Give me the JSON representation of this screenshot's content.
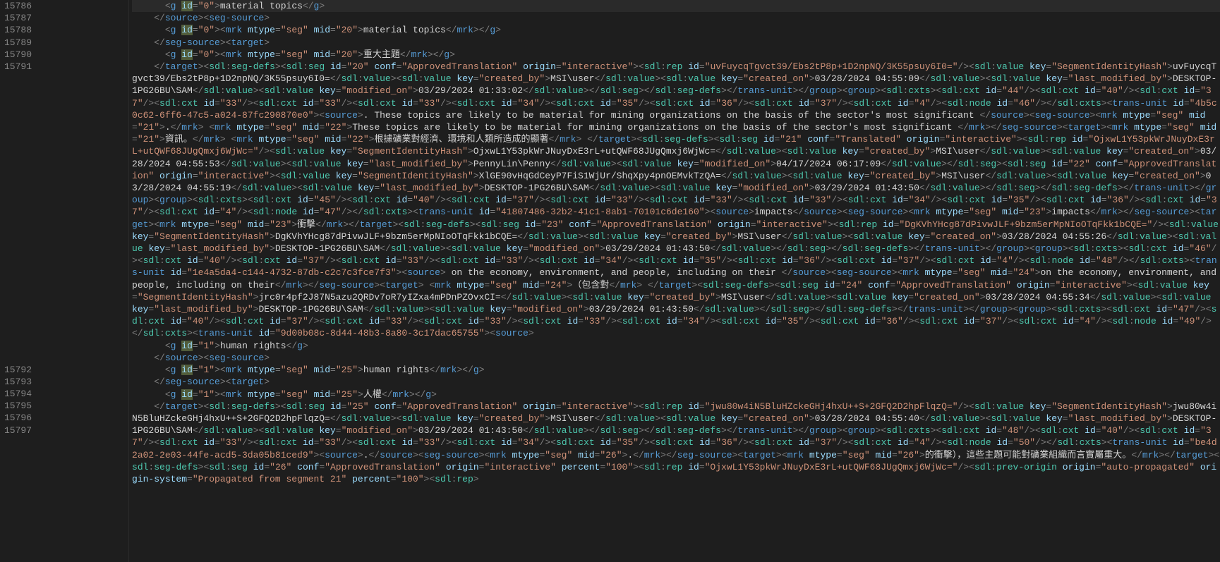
{
  "lineNumbers": [
    "15786",
    "15787",
    "15788",
    "15789",
    "15790",
    "15791",
    "",
    "",
    "",
    "",
    "",
    "",
    "",
    "",
    "",
    "",
    "",
    "",
    "",
    "",
    "",
    "",
    "",
    "",
    "",
    "",
    "",
    "",
    "",
    "",
    "15792",
    "15793",
    "15794",
    "15795",
    "15796",
    "15797",
    "",
    "",
    "",
    "",
    ""
  ],
  "tokens": {
    "g": "g",
    "id": "id",
    "eq": "=",
    "lt": "<",
    "gt": ">",
    "slash": "/",
    "quote": "\"",
    "source": "source",
    "seg_source": "seg-source",
    "target": "target",
    "mrk": "mrk",
    "mtype": "mtype",
    "seg": "seg",
    "mid": "mid",
    "sdl_seg_defs": "sdl:seg-defs",
    "sdl_seg": "sdl:seg",
    "conf": "conf",
    "ApprovedTranslation": "ApprovedTranslation",
    "Translated": "Translated",
    "origin": "origin",
    "interactive": "interactive",
    "auto_propagated": "auto-propagated",
    "sdl_rep": "sdl:rep",
    "sdl_value": "sdl:value",
    "key": "key",
    "SegmentIdentityHash": "SegmentIdentityHash",
    "created_by": "created_by",
    "created_on": "created_on",
    "last_modified_by": "last_modified_by",
    "modified_on": "modified_on",
    "trans_unit": "trans-unit",
    "group": "group",
    "sdl_cxts": "sdl:cxts",
    "sdl_cxt": "sdl:cxt",
    "sdl_node": "sdl:node",
    "sdl_prev_origin": "sdl:prev-origin",
    "origin_system": "origin-system",
    "percent": "percent"
  },
  "values": {
    "zero": "0",
    "one": "1",
    "four": "4",
    "mid20": "20",
    "mid21": "21",
    "mid22": "22",
    "mid23": "23",
    "mid24": "24",
    "mid25": "25",
    "mid26": "26",
    "material_topics": "material topics",
    "major_topic_cn": "重大主題",
    "human_rights": "human rights",
    "human_rights_cn": "人權",
    "impacts": "impacts",
    "impacts_cn": "衝擊",
    "en_onbasis": ". These topics are likely to be material for mining organizations on the basis of the sector's most significant ",
    "en_onbasis2": "These topics are likely to be material for mining organizations on the basis of the sector's most significant ",
    "cn_infoImpact": "資訊。",
    "cn_miningImpact": "根據礦業對經濟、環境和人類所造成的顯著",
    "en_econ": " on the economy, environment, and people, including on their ",
    "en_econ2": "on the economy, environment, and people, including on their",
    "cn_include": "（包含對",
    "dot": ".",
    "cn_impact_line": "的衝擊），這些主題可能對礦業組織而言實屬重大。",
    "hash1": "uvFuycqTgvct39/Ebs2tP8p+1D2npNQ/3K55psuy6I0=",
    "hash2": "OjxwL1Y53pkWrJNuyDxE3rL+utQWF68JUgQmxj6WjWc=",
    "hash3": "XlGE90vHqGdCeyP7FiS1WjUr/ShqXpy4pnOEMvkTzQA=",
    "hash4": "DgKVhYHcg87dPivwJLF+9bzm5erMpNIoOTqFkk1bCQE=",
    "hash5": "jrc0r4pf2J87N5azu2QRDv7oR7yIZxa4mPDnPZOvxCI=",
    "hash6": "jwu80w4iN5BluHZckeGHj4hxU++S+2GFQ2D2hpFlqzQ=",
    "user_msi": "MSI\\user",
    "user_desk": "DESKTOP-1PG26BU\\SAM",
    "user_penny": "PennyLin\\Penny",
    "d1": "03/28/2024 04:55:09",
    "d2": "03/29/2024 01:33:02",
    "d3": "03/28/2024 04:55:53",
    "d4": "04/17/2024 06:17:09",
    "d5": "03/28/2024 04:55:19",
    "d6": "03/29/2024 01:43:50",
    "d7": "03/28/2024 04:55:26",
    "d8": "03/28/2024 04:55:34",
    "d9": "03/28/2024 04:55:40",
    "tu1": "4b5c0c62-6ff6-47c5-a024-87fc290870e0",
    "tu2": "41807486-32b2-41c1-8ab1-70101c6de160",
    "tu3": "1e4a5da4-c144-4732-87db-c2c7c3fce7f3",
    "tu4": "9d00b08c-8d44-48b3-8a80-3c17dac65755",
    "tu5": "be4d2a02-2e03-44fe-acd5-3da05b81ced9",
    "c33": "33",
    "c34": "34",
    "c35": "35",
    "c36": "36",
    "c37": "37",
    "c40": "40",
    "c44": "44",
    "c45": "45",
    "n46": "46",
    "n47": "47",
    "n48": "48",
    "n49": "49",
    "n50": "50",
    "propagated": "Propagated from segment 21",
    "p100": "100"
  },
  "chart_data": null
}
